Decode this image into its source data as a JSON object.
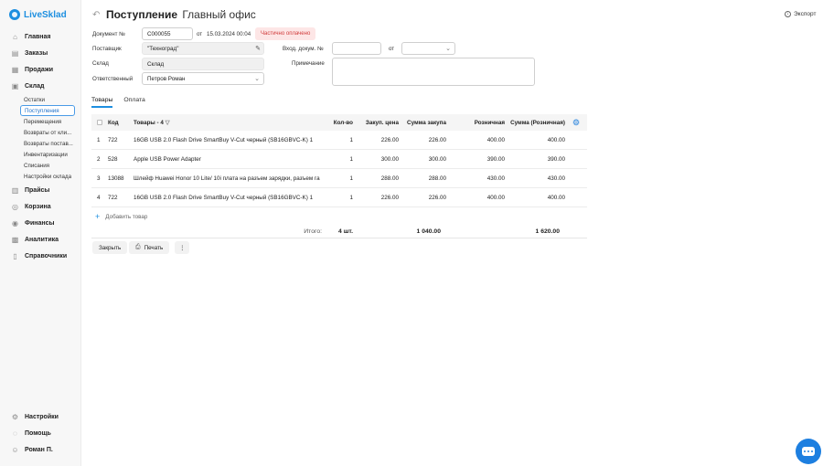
{
  "app": {
    "name": "LiveSklad"
  },
  "sidebar": {
    "items": [
      {
        "label": "Главная",
        "icon": "home-icon"
      },
      {
        "label": "Заказы",
        "icon": "orders-icon"
      },
      {
        "label": "Продажи",
        "icon": "sales-icon"
      },
      {
        "label": "Склад",
        "icon": "warehouse-icon"
      }
    ],
    "warehouse_sub": [
      {
        "label": "Остатки"
      },
      {
        "label": "Поступления",
        "active": true
      },
      {
        "label": "Перемещения"
      },
      {
        "label": "Возвраты от кли..."
      },
      {
        "label": "Возвраты постав..."
      },
      {
        "label": "Инвентаризации"
      },
      {
        "label": "Списания"
      },
      {
        "label": "Настройки склада"
      }
    ],
    "items_after": [
      {
        "label": "Прайсы",
        "icon": "prices-icon"
      },
      {
        "label": "Корзина",
        "icon": "cart-icon"
      },
      {
        "label": "Финансы",
        "icon": "finance-icon"
      },
      {
        "label": "Аналитика",
        "icon": "analytics-icon"
      },
      {
        "label": "Справочники",
        "icon": "reference-icon"
      }
    ],
    "bottom": [
      {
        "label": "Настройки",
        "icon": "settings-icon"
      },
      {
        "label": "Помощь",
        "icon": "help-icon"
      },
      {
        "label": "Роман П.",
        "icon": "user-icon"
      }
    ]
  },
  "header": {
    "title": "Поступление",
    "subtitle": "Главный офис",
    "export_label": "Экспорт"
  },
  "form": {
    "doc_no_label": "Документ №",
    "doc_no_value": "С000055",
    "from_label": "от",
    "date_value": "15.03.2024 00:04",
    "status_badge": "Частично оплачено",
    "supplier_label": "Поставщик",
    "supplier_value": "\"Техноград\"",
    "incoming_doc_label": "Вход. докум. №",
    "incoming_doc_value": "",
    "incoming_from_label": "от",
    "incoming_date_value": "",
    "warehouse_label": "Склад",
    "warehouse_value": "Склад",
    "note_label": "Примечание",
    "note_value": "",
    "responsible_label": "Ответственный",
    "responsible_value": "Петров Роман"
  },
  "tabs": [
    {
      "label": "Товары",
      "active": true
    },
    {
      "label": "Оплата",
      "active": false
    }
  ],
  "table": {
    "headers": {
      "code": "Код",
      "name": "Товары - 4",
      "qty": "Кол-во",
      "price": "Закуп. цена",
      "sum": "Сумма закупа",
      "retail": "Розничная",
      "retail_sum": "Сумма (Розничная)"
    },
    "rows": [
      {
        "n": "1",
        "code": "722",
        "name": "16GB USB 2.0 Flash Drive SmartBuy V-Cut черный (SB16GBVC-K) 1",
        "qty": "1",
        "price": "226.00",
        "sum": "226.00",
        "retail": "400.00",
        "retail_sum": "400.00"
      },
      {
        "n": "2",
        "code": "528",
        "name": "Apple USB Power Adapter",
        "qty": "1",
        "price": "300.00",
        "sum": "300.00",
        "retail": "390.00",
        "retail_sum": "390.00"
      },
      {
        "n": "3",
        "code": "13088",
        "name": "Шлейф Huawei Honor 10 Lite/ 10i плата на разъем зарядки, разъем га...",
        "qty": "1",
        "price": "288.00",
        "sum": "288.00",
        "retail": "430.00",
        "retail_sum": "430.00"
      },
      {
        "n": "4",
        "code": "722",
        "name": "16GB USB 2.0 Flash Drive SmartBuy V-Cut черный (SB16GBVC-K) 1",
        "qty": "1",
        "price": "226.00",
        "sum": "226.00",
        "retail": "400.00",
        "retail_sum": "400.00"
      }
    ],
    "add_label": "Добавить товар",
    "total_label": "Итого:",
    "total_qty": "4 шт.",
    "total_sum": "1 040.00",
    "total_retail_sum": "1 620.00"
  },
  "actions": {
    "close_label": "Закрыть",
    "print_label": "Печать",
    "more_label": "⋮"
  }
}
